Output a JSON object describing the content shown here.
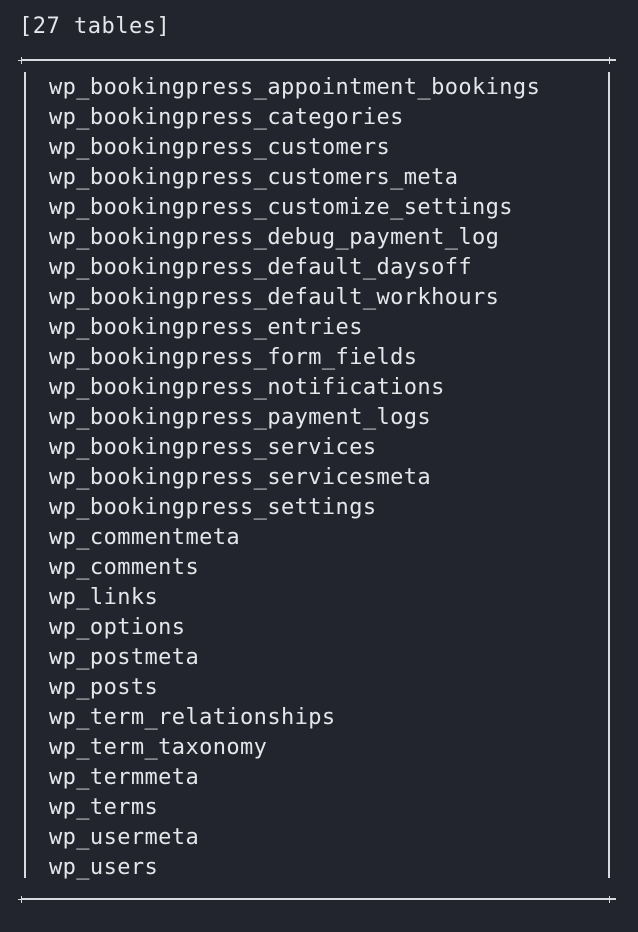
{
  "header": "[27 tables]",
  "tables": [
    "wp_bookingpress_appointment_bookings",
    "wp_bookingpress_categories",
    "wp_bookingpress_customers",
    "wp_bookingpress_customers_meta",
    "wp_bookingpress_customize_settings",
    "wp_bookingpress_debug_payment_log",
    "wp_bookingpress_default_daysoff",
    "wp_bookingpress_default_workhours",
    "wp_bookingpress_entries",
    "wp_bookingpress_form_fields",
    "wp_bookingpress_notifications",
    "wp_bookingpress_payment_logs",
    "wp_bookingpress_services",
    "wp_bookingpress_servicesmeta",
    "wp_bookingpress_settings",
    "wp_commentmeta",
    "wp_comments",
    "wp_links",
    "wp_options",
    "wp_postmeta",
    "wp_posts",
    "wp_term_relationships",
    "wp_term_taxonomy",
    "wp_termmeta",
    "wp_terms",
    "wp_usermeta",
    "wp_users"
  ]
}
